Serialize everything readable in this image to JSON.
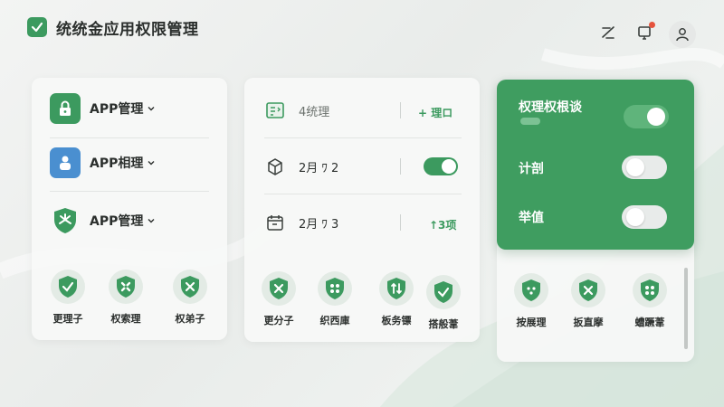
{
  "header": {
    "title": "统统金应用权限管理",
    "icons": [
      "edit-icon",
      "device-icon",
      "user-icon"
    ],
    "notification_color": "#e5533d"
  },
  "colors": {
    "accent": "#3c9a5f",
    "panel_green": "#3f9d60"
  },
  "card1": {
    "apps": [
      {
        "label": "APP管理",
        "icon": "lock-icon",
        "color": "#3c9a5f"
      },
      {
        "label": "APP相理",
        "icon": "person-icon",
        "color": "#4a8fd0"
      },
      {
        "label": "APP管理",
        "icon": "shield-fan-icon",
        "color": "#3c9a5f"
      }
    ],
    "shields": [
      {
        "label": "更理子",
        "icon": "shield-check-icon"
      },
      {
        "label": "权索理",
        "icon": "shield-fan-icon"
      },
      {
        "label": "权弟子",
        "icon": "shield-x-icon"
      }
    ]
  },
  "card2": {
    "rows": [
      {
        "text": "4统理",
        "icon": "id-card-icon",
        "action": "+ 理ロ"
      },
      {
        "text": "2月 ﾜ 2",
        "icon": "box-icon",
        "toggle": true
      },
      {
        "text": "2月 ﾜ 3",
        "icon": "calendar-icon",
        "action": "↑3项"
      }
    ],
    "shields": [
      {
        "label": "更分子",
        "icon": "shield-x-icon"
      },
      {
        "label": "织西庫",
        "icon": "shield-grid-icon"
      },
      {
        "label": "板务镖",
        "icon": "shield-arrows-icon"
      },
      {
        "label": "搭般葦",
        "icon": "shield-check-icon"
      }
    ]
  },
  "card3": {
    "settings": [
      {
        "label": "权理权根谈",
        "on": true
      },
      {
        "label": "计剖",
        "on": false
      },
      {
        "label": "举值",
        "on": false
      }
    ],
    "shields": [
      {
        "label": "按展理",
        "icon": "shield-dots-icon"
      },
      {
        "label": "扳直摩",
        "icon": "shield-x-icon"
      },
      {
        "label": "螬蹶葦",
        "icon": "shield-grid-icon"
      }
    ]
  }
}
